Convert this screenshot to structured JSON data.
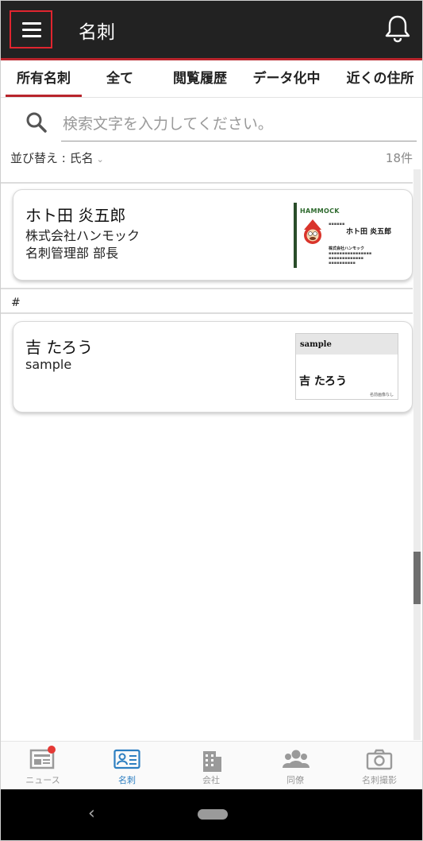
{
  "header": {
    "title": "名刺",
    "menu_icon": "hamburger-menu-icon",
    "notification_icon": "bell-icon",
    "colors": {
      "bar": "#222222",
      "accent": "#b8252c",
      "highlight": "#e0252f"
    }
  },
  "tabs": [
    {
      "label": "所有名刺",
      "active": true
    },
    {
      "label": "全て",
      "active": false
    },
    {
      "label": "閲覧履歴",
      "active": false
    },
    {
      "label": "データ化中",
      "active": false
    },
    {
      "label": "近くの住所",
      "active": false
    }
  ],
  "search": {
    "placeholder": "検索文字を入力してください。",
    "value": ""
  },
  "sort": {
    "label": "並び替え : 氏名",
    "count": "18件"
  },
  "cards": [
    {
      "name": "ホト田 炎五郎",
      "company": "株式会社ハンモック",
      "department": "名刺管理部 部長",
      "image": {
        "logo": "HAMMOCK",
        "name": "ホト田 炎五郎",
        "company": "株式会社ハンモック"
      }
    },
    {
      "name": "吉 たろう",
      "company": "sample",
      "image": {
        "header": "sample",
        "name": "吉 たろう",
        "note": "名前画像なし"
      }
    }
  ],
  "section_header": "#",
  "bottom_nav": [
    {
      "label": "ニュース",
      "icon": "news-icon",
      "active": false,
      "badge": true
    },
    {
      "label": "名刺",
      "icon": "business-card-icon",
      "active": true,
      "badge": false
    },
    {
      "label": "会社",
      "icon": "building-icon",
      "active": false,
      "badge": false
    },
    {
      "label": "同僚",
      "icon": "colleagues-icon",
      "active": false,
      "badge": false
    },
    {
      "label": "名刺撮影",
      "icon": "camera-icon",
      "active": false,
      "badge": false
    }
  ],
  "system_nav": {
    "back_icon": "back-chevron-icon",
    "home_icon": "home-pill-icon"
  }
}
